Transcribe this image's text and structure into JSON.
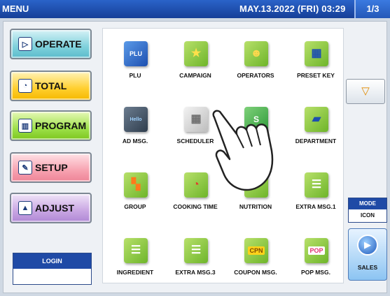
{
  "topbar": {
    "title": "MENU",
    "datetime": "MAY.13.2022 (FRI)  03:29",
    "page": "1/3"
  },
  "left_buttons": [
    {
      "label": "OPERATE",
      "icon": "play-circle-icon"
    },
    {
      "label": "TOTAL",
      "icon": "clock-icon"
    },
    {
      "label": "PROGRAM",
      "icon": "book-icon"
    },
    {
      "label": "SETUP",
      "icon": "tools-icon"
    },
    {
      "label": "ADJUST",
      "icon": "scale-icon"
    }
  ],
  "login": {
    "label": "LOGIN",
    "value": ""
  },
  "tiles": [
    {
      "label": "PLU",
      "icon": "plu-icon",
      "text": "PLU"
    },
    {
      "label": "CAMPAIGN",
      "icon": "star-icon",
      "text": ""
    },
    {
      "label": "OPERATORS",
      "icon": "operator-person-icon",
      "text": ""
    },
    {
      "label": "PRESET KEY",
      "icon": "keyboard-icon",
      "text": ""
    },
    {
      "label": "AD MSG.",
      "icon": "monitor-icon",
      "text": "Hello"
    },
    {
      "label": "SCHEDULER",
      "icon": "calendar-icon",
      "text": ""
    },
    {
      "label": "",
      "icon": "store-icon",
      "text": "S"
    },
    {
      "label": "DEPARTMENT",
      "icon": "folder-icon",
      "text": ""
    },
    {
      "label": "GROUP",
      "icon": "group-blocks-icon",
      "text": ""
    },
    {
      "label": "COOKING TIME",
      "icon": "stopwatch-icon",
      "text": ""
    },
    {
      "label": "NUTRITION",
      "icon": "utensils-icon",
      "text": ""
    },
    {
      "label": "EXTRA MSG.1",
      "icon": "message-icon",
      "text": ""
    },
    {
      "label": "INGREDIENT",
      "icon": "message-icon",
      "text": ""
    },
    {
      "label": "EXTRA MSG.3",
      "icon": "message-icon",
      "text": ""
    },
    {
      "label": "COUPON MSG.",
      "icon": "coupon-icon",
      "text": "CPN"
    },
    {
      "label": "POP MSG.",
      "icon": "pop-tag-icon",
      "text": "POP"
    }
  ],
  "right": {
    "scroll_down_icon": "triangle-down-icon",
    "mode": {
      "label": "MODE",
      "value": "ICON"
    },
    "sales": {
      "label": "SALES",
      "icon": "sales-play-icon"
    }
  }
}
